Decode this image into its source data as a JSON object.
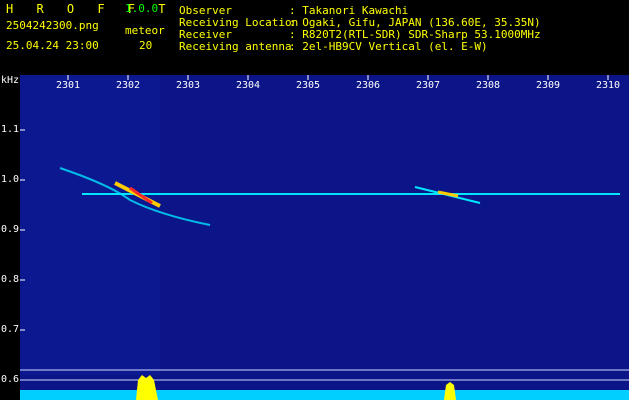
{
  "header": {
    "app_name": "H R O F F T",
    "app_version": "1.0.0",
    "file_name": "2504242300.png",
    "timestamp": "25.04.24 23:00",
    "meteor_label": "meteor",
    "meteor_count": "20",
    "fields": [
      {
        "label": "Observer",
        "value": ": Takanori Kawachi"
      },
      {
        "label": "Receiving Location",
        "value": ": Ogaki, Gifu, JAPAN (136.60E, 35.35N)"
      },
      {
        "label": "Receiver",
        "value": ": R820T2(RTL-SDR) SDR-Sharp 53.1000MHz"
      },
      {
        "label": "Receiving antenna",
        "value": ": 2el-HB9CV Vertical (el. E-W)"
      }
    ]
  },
  "colors": {
    "background": "#000000",
    "plot_bg": "#0b1587",
    "header_label": "#ffff00",
    "header_green": "#00ff00",
    "trace_cyan": "#00e5ff",
    "meteor_hot": "#ff2a2a",
    "meteor_mid": "#ffcc00",
    "bottom_bar": "#00cfff"
  },
  "axes": {
    "y_unit": "kHz",
    "y_ticks": [
      "1.1",
      "1.0",
      "0.9",
      "0.8",
      "0.7",
      "0.6"
    ],
    "x_ticks": [
      "2301",
      "2302",
      "2303",
      "2304",
      "2305",
      "2306",
      "2307",
      "2308",
      "2309",
      "2310"
    ]
  }
}
